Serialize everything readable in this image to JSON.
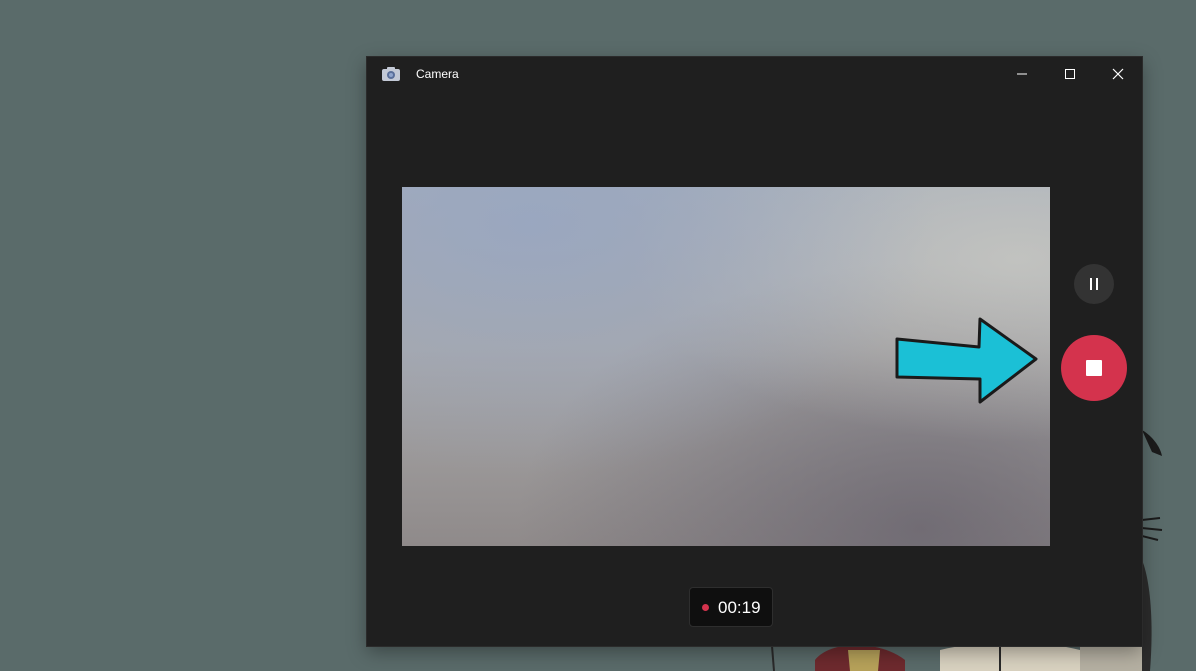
{
  "window": {
    "title": "Camera",
    "icon": "camera-icon",
    "controls": [
      "minimize-icon",
      "maximize-icon",
      "close-icon"
    ]
  },
  "controls": {
    "pause_icon": "pause-icon",
    "stop_icon": "stop-icon",
    "stop_color": "#d4334d"
  },
  "recording": {
    "time": "00:19",
    "indicator_color": "#d4334d"
  },
  "annotation": {
    "arrow_color": "#1bc0d6",
    "arrow_icon": "arrow-right-icon"
  }
}
